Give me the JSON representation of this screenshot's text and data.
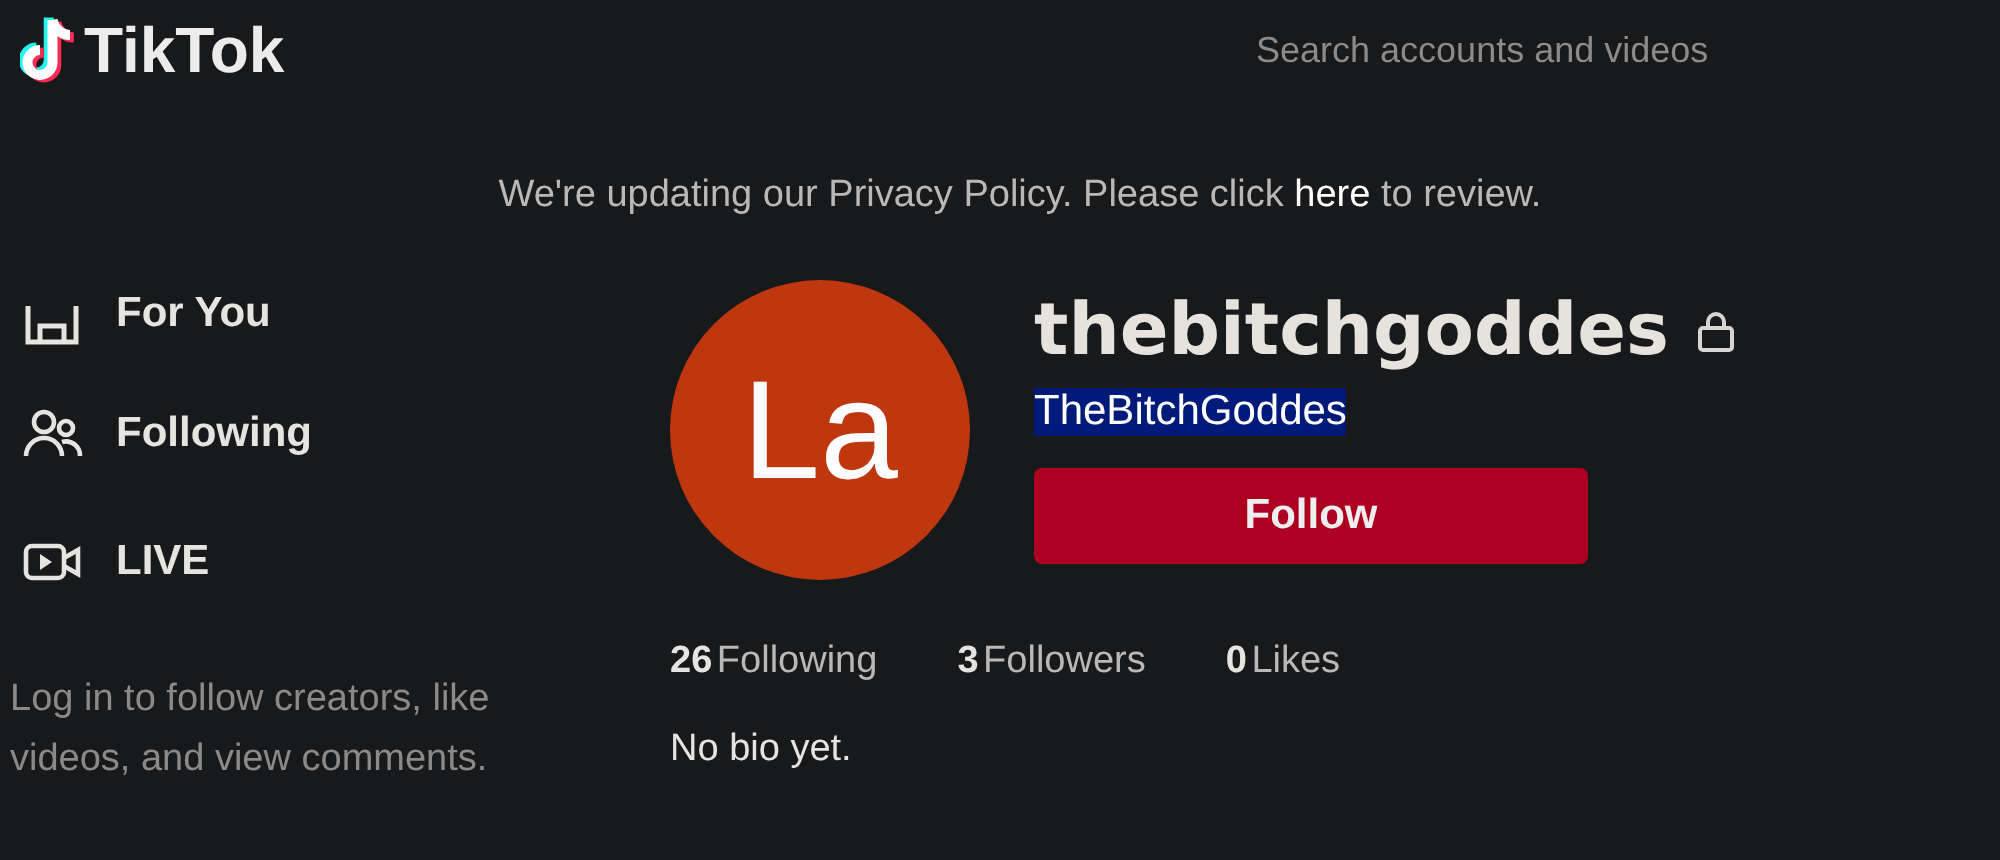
{
  "header": {
    "logo": "TikTok",
    "search": {
      "placeholder": "Search accounts and videos"
    }
  },
  "banner": {
    "text": "We're updating our Privacy Policy. Please click ",
    "link": "here",
    "after": " to review."
  },
  "sidebar": {
    "items": [
      {
        "label": "For You",
        "kind": "home",
        "selected": false
      },
      {
        "label": "Following",
        "kind": "people",
        "selected": false
      },
      {
        "label": "LIVE",
        "kind": "live",
        "selected": false
      }
    ],
    "login_prompt": "Log in to follow creators, like videos, and view comments."
  },
  "profile": {
    "avatar_initials": "La",
    "username": "thebitchgoddes",
    "private": true,
    "nickname": {
      "text": "TheBitchGoddes",
      "selected": true
    },
    "follow_button": "Follow",
    "stats": [
      {
        "value": "26",
        "label": "Following"
      },
      {
        "value": "3",
        "label": "Followers"
      },
      {
        "value": "0",
        "label": "Likes"
      }
    ],
    "bio": "No bio yet."
  }
}
